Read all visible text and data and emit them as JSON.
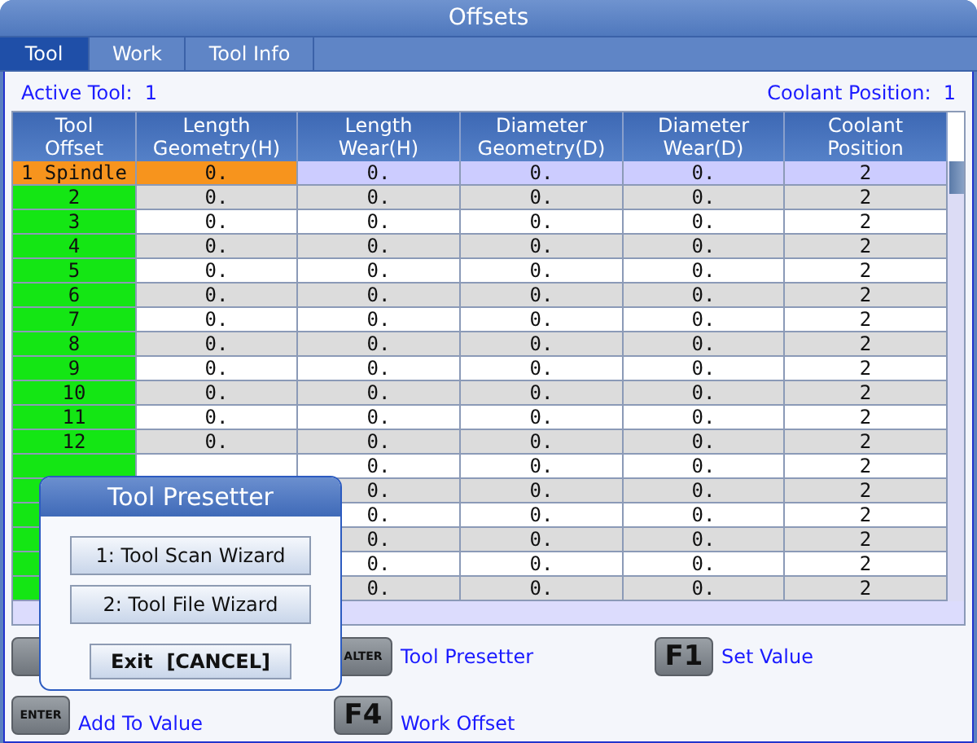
{
  "window": {
    "title": "Offsets"
  },
  "tabs": [
    {
      "label": "Tool",
      "selected": true
    },
    {
      "label": "Work",
      "selected": false
    },
    {
      "label": "Tool Info",
      "selected": false
    }
  ],
  "active_tool": {
    "label": "Active Tool:",
    "value": "1"
  },
  "coolant_position": {
    "label": "Coolant Position:",
    "value": "1"
  },
  "table": {
    "columns": [
      "Tool Offset",
      "Length Geometry(H)",
      "Length Wear(H)",
      "Diameter Geometry(D)",
      "Diameter Wear(D)",
      "Coolant Position"
    ],
    "rows": [
      {
        "selected": true,
        "cells": [
          "1 Spindle",
          "0.",
          "0.",
          "0.",
          "0.",
          "2"
        ]
      },
      {
        "selected": false,
        "cells": [
          "2",
          "0.",
          "0.",
          "0.",
          "0.",
          "2"
        ]
      },
      {
        "selected": false,
        "cells": [
          "3",
          "0.",
          "0.",
          "0.",
          "0.",
          "2"
        ]
      },
      {
        "selected": false,
        "cells": [
          "4",
          "0.",
          "0.",
          "0.",
          "0.",
          "2"
        ]
      },
      {
        "selected": false,
        "cells": [
          "5",
          "0.",
          "0.",
          "0.",
          "0.",
          "2"
        ]
      },
      {
        "selected": false,
        "cells": [
          "6",
          "0.",
          "0.",
          "0.",
          "0.",
          "2"
        ]
      },
      {
        "selected": false,
        "cells": [
          "7",
          "0.",
          "0.",
          "0.",
          "0.",
          "2"
        ]
      },
      {
        "selected": false,
        "cells": [
          "8",
          "0.",
          "0.",
          "0.",
          "0.",
          "2"
        ]
      },
      {
        "selected": false,
        "cells": [
          "9",
          "0.",
          "0.",
          "0.",
          "0.",
          "2"
        ]
      },
      {
        "selected": false,
        "cells": [
          "10",
          "0.",
          "0.",
          "0.",
          "0.",
          "2"
        ]
      },
      {
        "selected": false,
        "cells": [
          "11",
          "0.",
          "0.",
          "0.",
          "0.",
          "2"
        ]
      },
      {
        "selected": false,
        "cells": [
          "12",
          "0.",
          "0.",
          "0.",
          "0.",
          "2"
        ]
      },
      {
        "selected": false,
        "cells": [
          "0.",
          "0.",
          "0.",
          "2"
        ]
      },
      {
        "selected": false,
        "cells": [
          "0.",
          "0.",
          "0.",
          "2"
        ]
      },
      {
        "selected": false,
        "cells": [
          "0.",
          "0.",
          "0.",
          "2"
        ]
      },
      {
        "selected": false,
        "cells": [
          "0.",
          "0.",
          "0.",
          "2"
        ]
      },
      {
        "selected": false,
        "cells": [
          "0.",
          "0.",
          "0.",
          "2"
        ]
      },
      {
        "selected": false,
        "cells": [
          "0.",
          "0.",
          "0.",
          "2"
        ]
      }
    ]
  },
  "key_legend": [
    {
      "kind": "blank"
    },
    {
      "kind": "small",
      "key": "ALTER",
      "label": "Tool Presetter"
    },
    {
      "kind": "large",
      "key": "F1",
      "label": "Set Value"
    },
    {
      "kind": "small",
      "key": "ENTER",
      "label": "Add To Value"
    },
    {
      "kind": "large",
      "key": "F4",
      "label": "Work Offset"
    }
  ],
  "dialog": {
    "title": "Tool Presetter",
    "options": [
      "1: Tool Scan Wizard",
      "2: Tool File Wizard"
    ],
    "cancel": "Exit  [CANCEL]"
  }
}
